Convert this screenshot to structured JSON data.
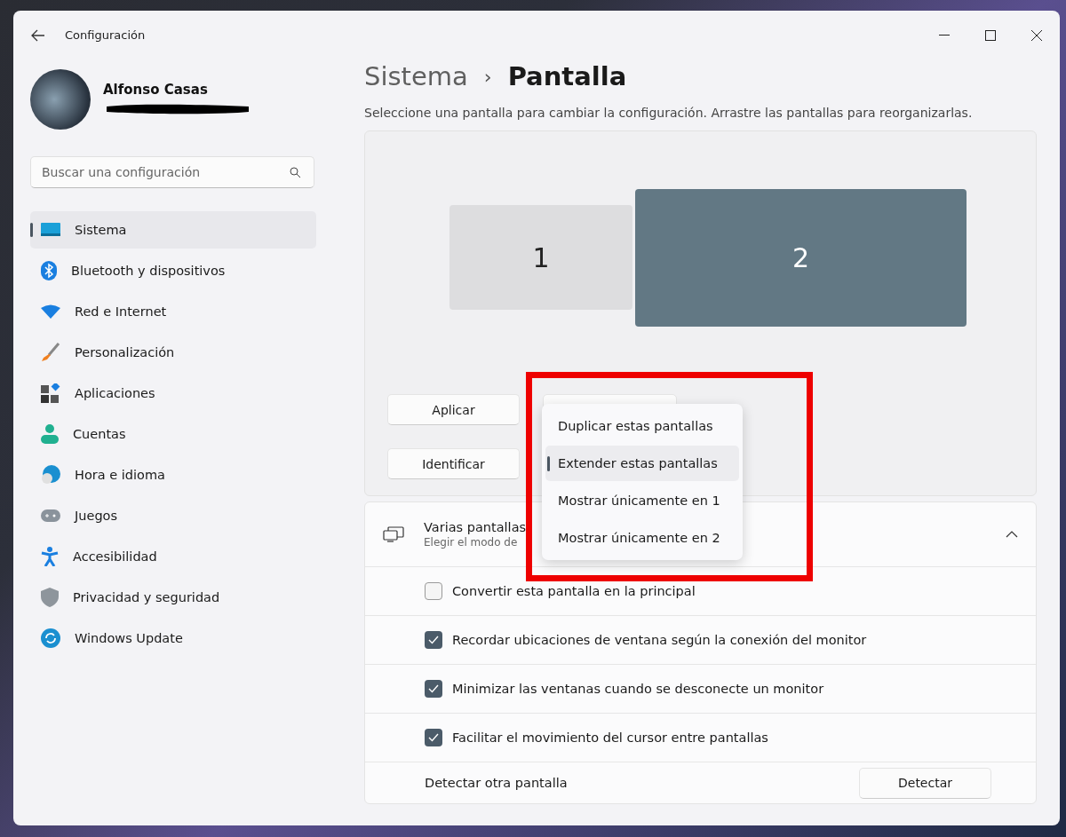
{
  "window": {
    "title": "Configuración"
  },
  "profile": {
    "name": "Alfonso Casas"
  },
  "search": {
    "placeholder": "Buscar una configuración"
  },
  "sidebar": {
    "items": [
      {
        "label": "Sistema",
        "selected": true
      },
      {
        "label": "Bluetooth y dispositivos",
        "selected": false
      },
      {
        "label": "Red e Internet",
        "selected": false
      },
      {
        "label": "Personalización",
        "selected": false
      },
      {
        "label": "Aplicaciones",
        "selected": false
      },
      {
        "label": "Cuentas",
        "selected": false
      },
      {
        "label": "Hora e idioma",
        "selected": false
      },
      {
        "label": "Juegos",
        "selected": false
      },
      {
        "label": "Accesibilidad",
        "selected": false
      },
      {
        "label": "Privacidad y seguridad",
        "selected": false
      },
      {
        "label": "Windows Update",
        "selected": false
      }
    ]
  },
  "breadcrumb": {
    "parent": "Sistema",
    "separator": "›",
    "current": "Pantalla"
  },
  "description": "Seleccione una pantalla para cambiar la configuración. Arrastre las pantallas para reorganizarlas.",
  "displays": [
    {
      "label": "1",
      "selected": false
    },
    {
      "label": "2",
      "selected": true
    }
  ],
  "buttons": {
    "apply": "Aplicar",
    "identify": "Identificar"
  },
  "dropdown": {
    "options": [
      {
        "label": "Duplicar estas pantallas",
        "selected": false
      },
      {
        "label": "Extender estas pantallas",
        "selected": true
      },
      {
        "label": "Mostrar únicamente en 1",
        "selected": false
      },
      {
        "label": "Mostrar únicamente en 2",
        "selected": false
      }
    ]
  },
  "multi_display": {
    "title": "Varias pantallas",
    "subtitle": "Elegir el modo de",
    "expanded": true,
    "options": [
      {
        "label": "Convertir esta pantalla en la principal",
        "checked": false
      },
      {
        "label": "Recordar ubicaciones de ventana según la conexión del monitor",
        "checked": true
      },
      {
        "label": "Minimizar las ventanas cuando se desconecte un monitor",
        "checked": true
      },
      {
        "label": "Facilitar el movimiento del cursor entre pantallas",
        "checked": true
      }
    ],
    "detect": {
      "label": "Detectar otra pantalla",
      "button": "Detectar"
    }
  }
}
